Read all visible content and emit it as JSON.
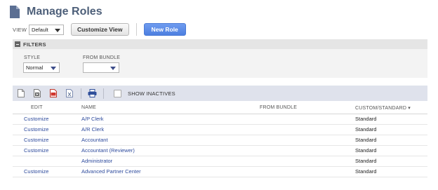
{
  "header": {
    "title": "Manage Roles"
  },
  "toolbar": {
    "view_label": "VIEW",
    "view_value": "Default",
    "customize_view_label": "Customize View",
    "new_role_label": "New Role"
  },
  "filters": {
    "title": "FILTERS",
    "style_label": "STYLE",
    "style_value": "Normal",
    "bundle_label": "FROM BUNDLE",
    "bundle_value": ""
  },
  "list_toolbar": {
    "icons": [
      "new-document-icon",
      "export-csv-icon",
      "export-pdf-icon",
      "export-excel-icon",
      "print-icon"
    ],
    "show_inactives_label": "SHOW INACTIVES"
  },
  "table": {
    "columns": {
      "edit": "EDIT",
      "name": "NAME",
      "bundle": "FROM BUNDLE",
      "custom": "CUSTOM/STANDARD ▾"
    },
    "rows": [
      {
        "edit": "Customize",
        "name": "A/P Clerk",
        "bundle": "",
        "custom": "Standard"
      },
      {
        "edit": "Customize",
        "name": "A/R Clerk",
        "bundle": "",
        "custom": "Standard"
      },
      {
        "edit": "Customize",
        "name": "Accountant",
        "bundle": "",
        "custom": "Standard"
      },
      {
        "edit": "Customize",
        "name": "Accountant (Reviewer)",
        "bundle": "",
        "custom": "Standard"
      },
      {
        "edit": "",
        "name": "Administrator",
        "bundle": "",
        "custom": "Standard"
      },
      {
        "edit": "Customize",
        "name": "Advanced Partner Center",
        "bundle": "",
        "custom": "Standard"
      }
    ]
  },
  "colors": {
    "title": "#4d5f79",
    "link": "#2d4a9c",
    "primary_button": "#4d7fe0",
    "list_toolbar_bg": "#dfe2ec"
  }
}
